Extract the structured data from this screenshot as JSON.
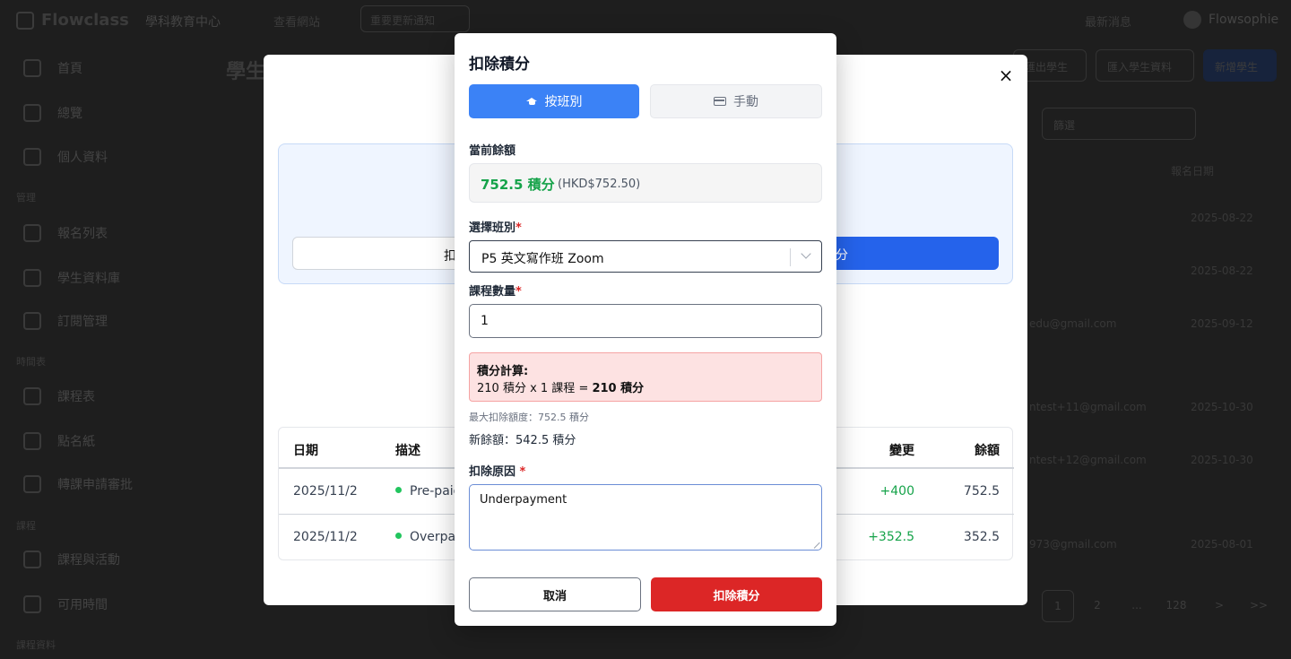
{
  "app": {
    "brand": "Flowclass",
    "org": "學科教育中心",
    "topbar_link": "查看網站",
    "topbar_button": "重要更新通知",
    "notifications": "最新消息",
    "user": "Flowsophie"
  },
  "sidebar": {
    "items": [
      {
        "label": "首頁"
      },
      {
        "label": "總覽"
      },
      {
        "label": "個人資料"
      },
      {
        "label": "報名列表"
      },
      {
        "label": "學生資料庫"
      },
      {
        "label": "訂閱管理"
      },
      {
        "label": "課程表"
      },
      {
        "label": "點名紙"
      },
      {
        "label": "轉課申請審批"
      },
      {
        "label": "課程與活動"
      },
      {
        "label": "可用時間"
      }
    ],
    "sections": [
      "管理",
      "時間表",
      "課程",
      "課程資料"
    ]
  },
  "background": {
    "page_title": "學生",
    "buttons": [
      "匯出學生",
      "匯入學生資料",
      "新增學生"
    ],
    "filter": "篩選",
    "col_header": "報名日期",
    "dates": [
      "2025-08-22",
      "2025-08-22",
      "2025-09-12",
      "2025-10-30",
      "2025-10-30",
      "2025-08-01"
    ],
    "emails": [
      "edu@gmail.com",
      "ntest+11@gmail.com",
      "ntest+12@gmail.com",
      "973@gmail.com"
    ],
    "pager": [
      "1",
      "2",
      "...",
      "128",
      ">",
      ">>"
    ]
  },
  "outer_modal": {
    "close_label": "×",
    "deduct_tab": "扣",
    "add_tab": "分",
    "table": {
      "headers": {
        "date": "日期",
        "desc": "描述",
        "change": "變更",
        "balance": "餘額"
      },
      "rows": [
        {
          "date": "2025/11/2",
          "desc": "Pre-paid",
          "change": "+400",
          "balance": "752.5"
        },
        {
          "date": "2025/11/2",
          "desc": "Overpay",
          "change": "+352.5",
          "balance": "352.5"
        }
      ]
    }
  },
  "dialog": {
    "title": "扣除積分",
    "tabs": {
      "by_class": "按班別",
      "manual": "手動"
    },
    "current_balance_label": "當前餘額",
    "balance_points": "752.5 積分",
    "balance_hkd": "(HKD$752.50)",
    "class_label": "選擇班別",
    "class_value": "P5 英文寫作班 Zoom",
    "qty_label": "課程數量",
    "qty_value": "1",
    "calc_title": "積分計算:",
    "calc_line_prefix": "210 積分 x 1 課程 = ",
    "calc_line_result": "210 積分",
    "max_note": "最大扣除額度：752.5 積分",
    "new_balance": "新餘額：542.5 積分",
    "reason_label": "扣除原因",
    "reason_value": "Underpayment",
    "cancel_label": "取消",
    "deduct_label": "扣除積分",
    "required_mark": "*",
    "colors": {
      "primary": "#3b82f6",
      "danger": "#dc2626",
      "success": "#16a34a"
    },
    "icons": {
      "by_class": "graduation-cap-icon",
      "manual": "credit-card-icon",
      "select": "chevron-down-icon"
    }
  }
}
